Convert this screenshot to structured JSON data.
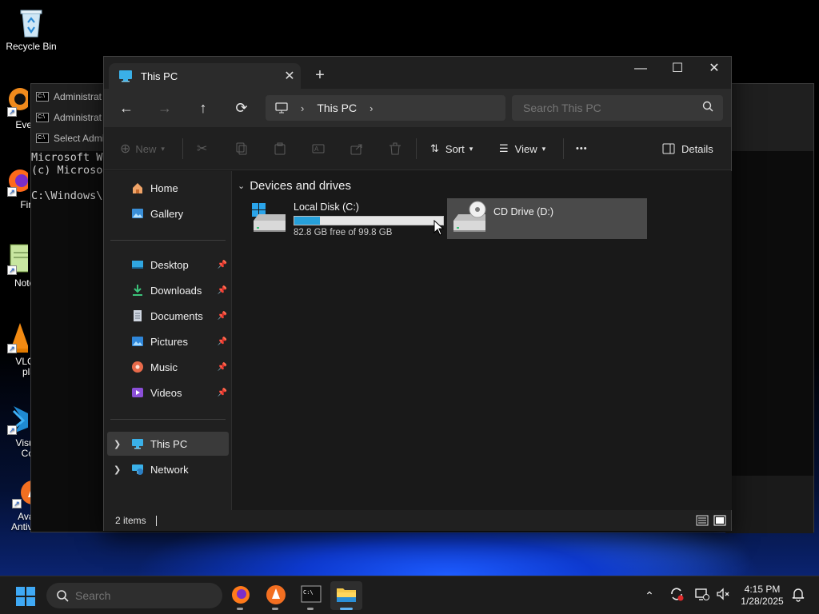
{
  "desktop": {
    "icons": [
      {
        "label": "Recycle Bin",
        "icon": "recycle-bin-icon"
      },
      {
        "label": "Every",
        "icon": "everything-icon"
      },
      {
        "label": "Fire",
        "icon": "firefox-icon"
      },
      {
        "label": "Notep",
        "icon": "notepad-icon"
      },
      {
        "label": "VLC r",
        "label2": "pla",
        "icon": "vlc-icon"
      },
      {
        "label": "Visual",
        "label2": "Co",
        "icon": "vscode-icon"
      },
      {
        "label": "Avast",
        "label2": "Antivirus",
        "icon": "avast-icon"
      }
    ]
  },
  "terminal": {
    "tabs": [
      "Administrat",
      "Administrat",
      "Select Admi"
    ],
    "lines": "Microsoft Wi\n(c) Microso\n\nC:\\Windows\\S"
  },
  "explorer": {
    "tab_title": "This PC",
    "new_tab": "+",
    "window_controls": {
      "minimize": "—",
      "maximize": "☐",
      "close": "✕"
    },
    "address": {
      "segment": "This PC"
    },
    "search": {
      "placeholder": "Search This PC"
    },
    "commands": {
      "new": "New",
      "sort": "Sort",
      "view": "View",
      "more": "•••",
      "details": "Details"
    },
    "nav": {
      "home": "Home",
      "gallery": "Gallery",
      "pinned": [
        {
          "label": "Desktop",
          "icon": "desktop-folder-icon"
        },
        {
          "label": "Downloads",
          "icon": "downloads-folder-icon"
        },
        {
          "label": "Documents",
          "icon": "documents-folder-icon"
        },
        {
          "label": "Pictures",
          "icon": "pictures-folder-icon"
        },
        {
          "label": "Music",
          "icon": "music-folder-icon"
        },
        {
          "label": "Videos",
          "icon": "videos-folder-icon"
        }
      ],
      "this_pc": "This PC",
      "network": "Network"
    },
    "group": "Devices and drives",
    "drives": [
      {
        "name": "Local Disk (C:)",
        "free_text": "82.8 GB free of 99.8 GB",
        "used_fraction": 0.17
      },
      {
        "name": "CD Drive (D:)"
      }
    ],
    "status": {
      "items": "2 items"
    }
  },
  "taskbar": {
    "search_placeholder": "Search",
    "apps": [
      "firefox-icon",
      "avast-icon",
      "terminal-icon",
      "file-explorer-icon"
    ],
    "clock": {
      "time": "4:15 PM",
      "date": "1/28/2025"
    }
  },
  "colors": {
    "accent": "#26a0da",
    "window_bg": "#191919",
    "taskbar_bg": "#1c1c1c"
  }
}
